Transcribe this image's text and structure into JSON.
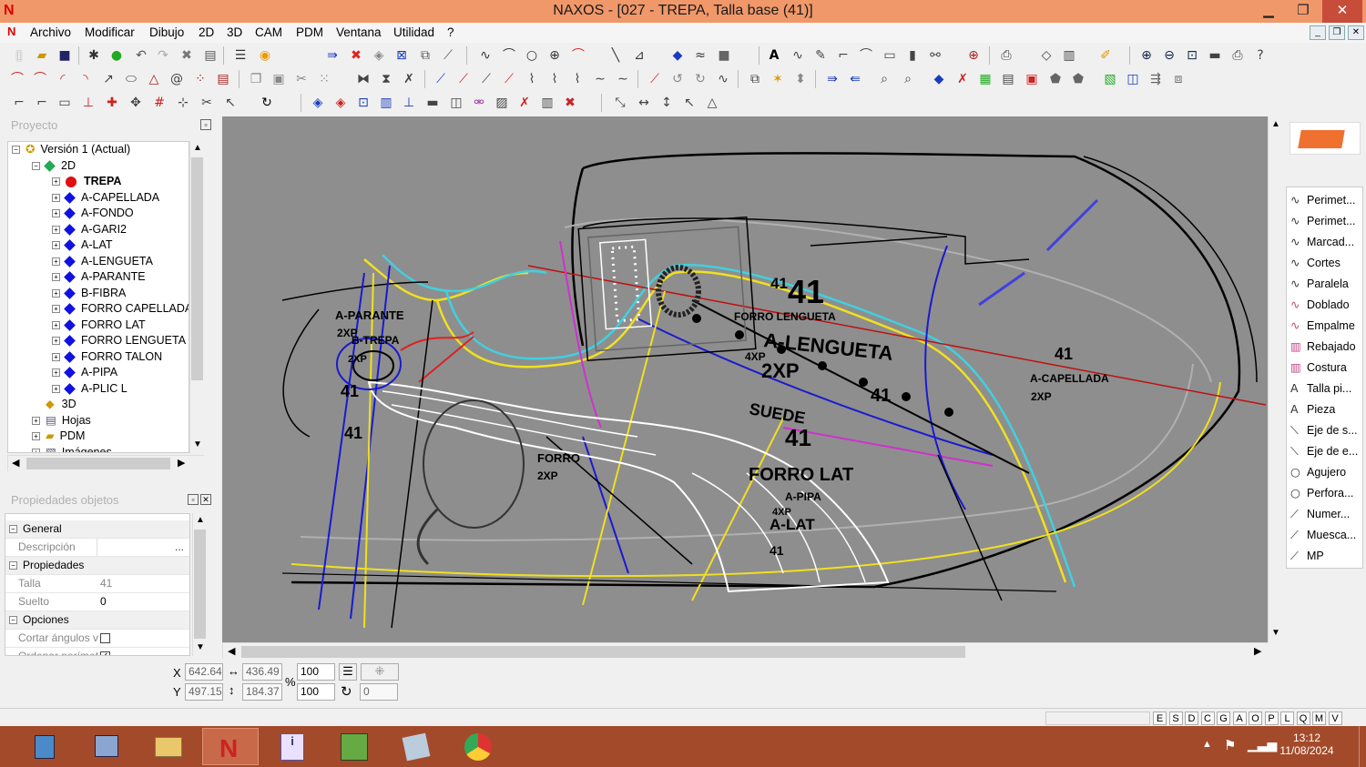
{
  "window": {
    "title": "NAXOS - [027 - TREPA, Talla base (41)]",
    "min": "▁",
    "max": "❐",
    "close": "✕"
  },
  "menu": [
    "Archivo",
    "Modificar",
    "Dibujo",
    "2D",
    "3D",
    "CAM",
    "PDM",
    "Ventana",
    "Utilidad",
    "?"
  ],
  "project": {
    "title": "Proyecto",
    "root": "Versión 1 (Actual)",
    "node2d": "2D",
    "items": [
      "TREPA",
      "A-CAPELLADA",
      "A-FONDO",
      "A-GARI2",
      "A-LAT",
      "A-LENGUETA",
      "A-PARANTE",
      "B-FIBRA",
      "FORRO CAPELLADA",
      "FORRO LAT",
      "FORRO LENGUETA",
      "FORRO TALON",
      "A-PIPA",
      "A-PLIC L"
    ],
    "others": [
      "3D",
      "Hojas",
      "PDM",
      "Imágenes"
    ]
  },
  "props": {
    "title": "Propiedades objetos",
    "general": "General",
    "descripcion": "Descripción",
    "desc_btn": "...",
    "propiedades": "Propiedades",
    "talla_label": "Talla",
    "talla_value": "41",
    "suelto_label": "Suelto",
    "suelto_value": "0",
    "opciones": "Opciones",
    "cortar": "Cortar ángulos v",
    "ordenar": "Ordenar perímet"
  },
  "right_panel": [
    "Perimet...",
    "Perimet...",
    "Marcad...",
    "Cortes",
    "Paralela",
    "Doblado",
    "Empalme",
    "Rebajado",
    "Costura",
    "Talla pi...",
    "Pieza",
    "Eje de s...",
    "Eje de e...",
    "Agujero",
    "Perfora...",
    "Numer...",
    "Muesca...",
    "MP"
  ],
  "coords": {
    "x_label": "X",
    "y_label": "Y",
    "x": "642.64",
    "y": "497.15",
    "w": "436.49",
    "h": "184.37",
    "pct_x": "100",
    "pct_y": "100",
    "pct": "%",
    "rot": "0"
  },
  "status": [
    "E",
    "S",
    "D",
    "C",
    "G",
    "A",
    "O",
    "P",
    "L",
    "Q",
    "M",
    "V"
  ],
  "clock": {
    "time": "13:12",
    "date": "11/08/2024"
  },
  "drawing_labels": {
    "a41": "41",
    "a41b": "41",
    "lengueta": "A-LENGUETA",
    "forro_lengueta": "FORRO LENGUETA",
    "cap": "A-CAPELLADA",
    "x2p": "2XP",
    "x4p": "4XP",
    "x2p2": "2XP",
    "suede": "SUEDE",
    "forro_lat": "FORRO LAT",
    "pipa": "A-PIPA",
    "alat": "A-LAT",
    "parante": "A-PARANTE",
    "trepa": "B-TREPA",
    "forro_cap": "FORRO CAPELLADA",
    "forro": "FORRO",
    "x2pb": "2XP",
    "n41c": "41",
    "n41d": "41",
    "n41e": "41",
    "n41f": "41",
    "n41g": "41",
    "x2pc": "2XP",
    "x2pd": "2XP",
    "n41h": "41",
    "x4pb": "4XP",
    "x2pe": "2XP"
  }
}
